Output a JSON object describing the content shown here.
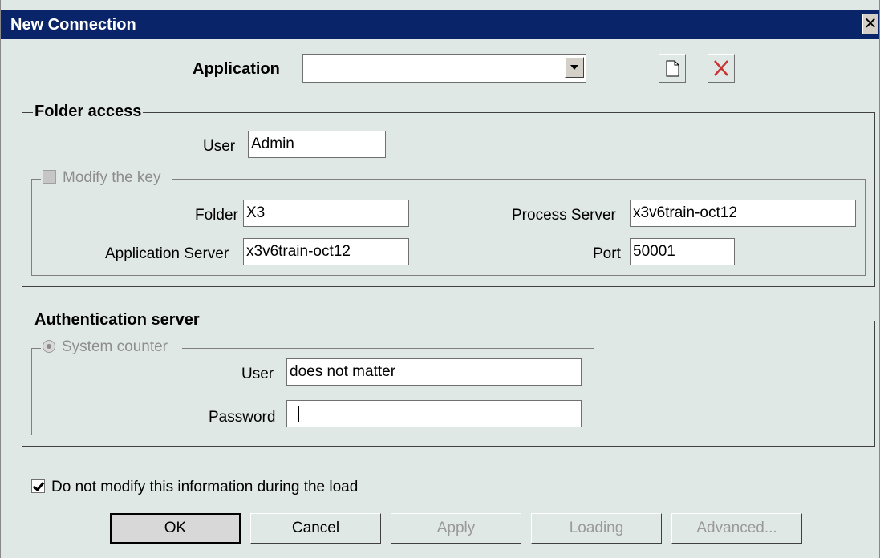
{
  "window": {
    "title": "New Connection",
    "close_glyph": "✕"
  },
  "application": {
    "label": "Application",
    "value": ""
  },
  "folder_access": {
    "title": "Folder access",
    "user_label": "User",
    "user_value": "Admin",
    "modify_key": {
      "label": "Modify the key",
      "checked": false,
      "disabled": true
    },
    "folder_label": "Folder",
    "folder_value": "X3",
    "app_server_label": "Application Server",
    "app_server_value": "x3v6train-oct12",
    "process_server_label": "Process Server",
    "process_server_value": "x3v6train-oct12",
    "port_label": "Port",
    "port_value": "50001"
  },
  "auth_server": {
    "title": "Authentication server",
    "system_counter": {
      "label": "System counter",
      "selected": true,
      "disabled": true
    },
    "user_label": "User",
    "user_value": "does not matter",
    "password_label": "Password",
    "password_value": ""
  },
  "no_modify": {
    "label": "Do not modify this information during the load",
    "checked": true
  },
  "buttons": {
    "ok": "OK",
    "cancel": "Cancel",
    "apply": "Apply",
    "loading": "Loading",
    "advanced": "Advanced..."
  },
  "colors": {
    "titlebar": "#0a246a",
    "dialog_bg": "#dfe8e4",
    "disabled_text": "#9a9a9a",
    "delete_icon": "#c83232"
  }
}
